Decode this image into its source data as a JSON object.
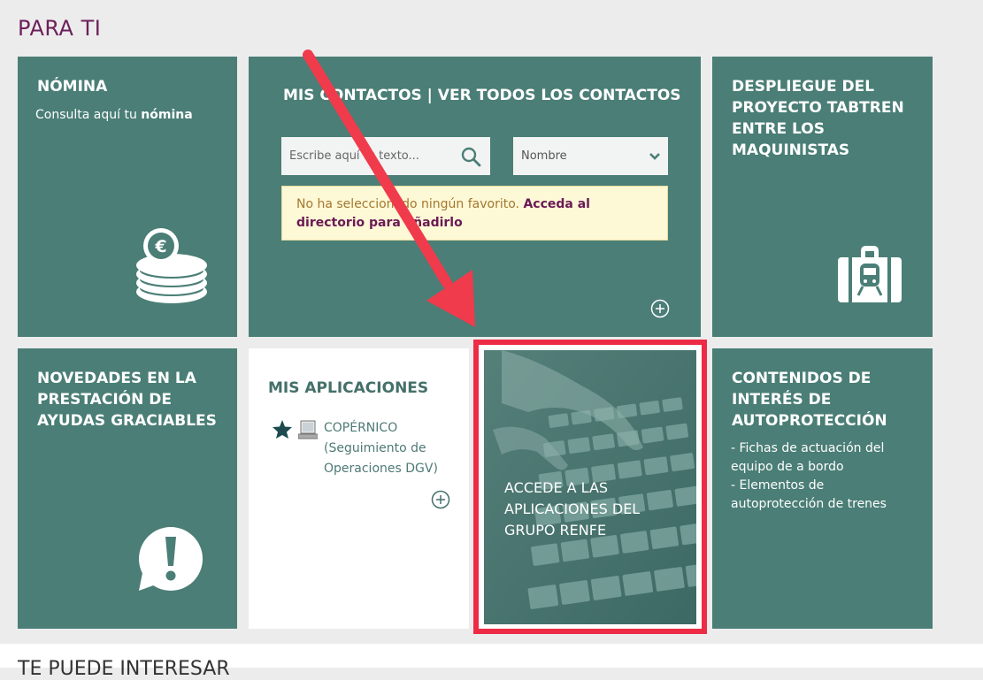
{
  "section": {
    "title": "PARA TI",
    "next_title": "TE PUEDE INTERESAR"
  },
  "nomina": {
    "title": "NÓMINA",
    "subtitle_prefix": "Consulta aquí tu ",
    "subtitle_bold": "nómina"
  },
  "contactos": {
    "title": "MIS CONTACTOS | VER TODOS LOS CONTACTOS",
    "search_placeholder": "Escribe aquí tu texto...",
    "select_value": "Nombre",
    "notice_text": "No ha seleccionado ningún favorito. ",
    "notice_link": "Acceda al directorio para añadirlo"
  },
  "despliegue": {
    "title_lines": [
      "DESPLIEGUE DEL",
      "PROYECTO TABTREN",
      "ENTRE LOS",
      "MAQUINISTAS"
    ]
  },
  "novedades": {
    "title_lines": [
      "NOVEDADES EN LA",
      "PRESTACIÓN DE",
      "AYUDAS GRACIABLES"
    ]
  },
  "aplicaciones": {
    "title": "MIS APLICACIONES",
    "items": [
      {
        "line1": "COPÉRNICO",
        "line2": "(Seguimiento de",
        "line3": "Operaciones DGV)"
      }
    ]
  },
  "accede": {
    "lines": [
      "ACCEDE A LAS",
      "APLICACIONES DEL",
      "GRUPO RENFE"
    ]
  },
  "contenidos": {
    "title_lines": [
      "CONTENIDOS DE",
      "INTERÉS DE",
      "AUTOPROTECCIÓN"
    ],
    "items": [
      {
        "line1": "- Fichas de actuación del",
        "line2": "equipo de a bordo"
      },
      {
        "line1": "- Elementos de",
        "line2": "autoprotección de trenes"
      }
    ]
  },
  "colors": {
    "tile": "#4a7e76",
    "accent": "#6d1f5a",
    "highlight": "#ee2b44",
    "arrow": "#ef3b4b"
  }
}
